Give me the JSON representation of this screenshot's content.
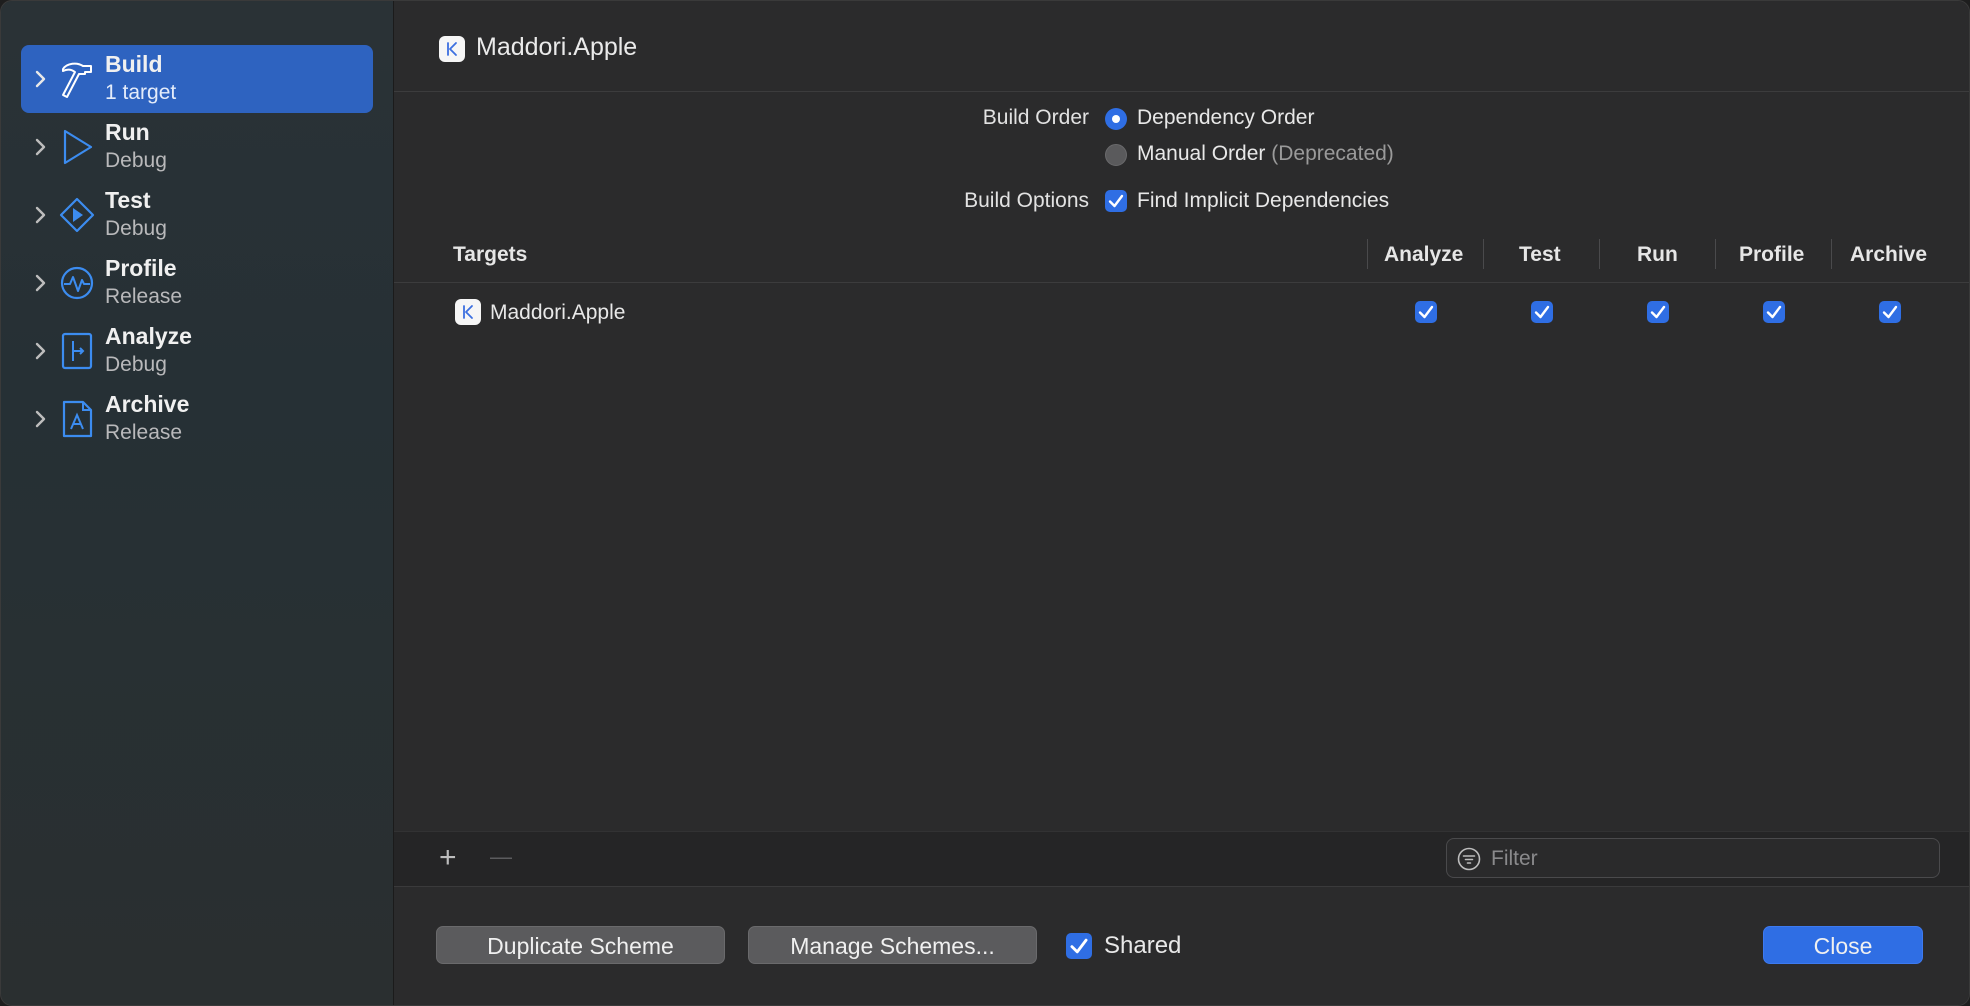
{
  "sidebar": {
    "actions": [
      {
        "name": "Build",
        "subtitle": "1 target",
        "icon": "hammer-icon",
        "selected": true
      },
      {
        "name": "Run",
        "subtitle": "Debug",
        "icon": "play-icon",
        "selected": false
      },
      {
        "name": "Test",
        "subtitle": "Debug",
        "icon": "test-diamond-icon",
        "selected": false
      },
      {
        "name": "Profile",
        "subtitle": "Release",
        "icon": "waveform-icon",
        "selected": false
      },
      {
        "name": "Analyze",
        "subtitle": "Debug",
        "icon": "analyze-branch-icon",
        "selected": false
      },
      {
        "name": "Archive",
        "subtitle": "Release",
        "icon": "archive-appstore-icon",
        "selected": false
      }
    ]
  },
  "header": {
    "title": "Maddori.Apple",
    "icon": "app-icon"
  },
  "build_order": {
    "label": "Build Order",
    "options": [
      {
        "label": "Dependency Order",
        "selected": true
      },
      {
        "label": "Manual Order",
        "note": "(Deprecated)",
        "selected": false
      }
    ]
  },
  "build_options": {
    "label": "Build Options",
    "find_implicit": {
      "label": "Find Implicit Dependencies",
      "checked": true
    }
  },
  "table": {
    "headers": {
      "targets": "Targets",
      "analyze": "Analyze",
      "test": "Test",
      "run": "Run",
      "profile": "Profile",
      "archive": "Archive"
    },
    "rows": [
      {
        "target": "Maddori.Apple",
        "analyze": true,
        "test": true,
        "run": true,
        "profile": true,
        "archive": true
      }
    ]
  },
  "toolbar": {
    "add": "+",
    "remove": "—",
    "filter_placeholder": "Filter"
  },
  "footer": {
    "duplicate": "Duplicate Scheme",
    "manage": "Manage Schemes...",
    "shared_label": "Shared",
    "shared_checked": true,
    "close": "Close"
  },
  "colors": {
    "accent": "#2f6ee4",
    "selected_row": "#2e63c0",
    "icon_blue": "#3c8cf0"
  }
}
